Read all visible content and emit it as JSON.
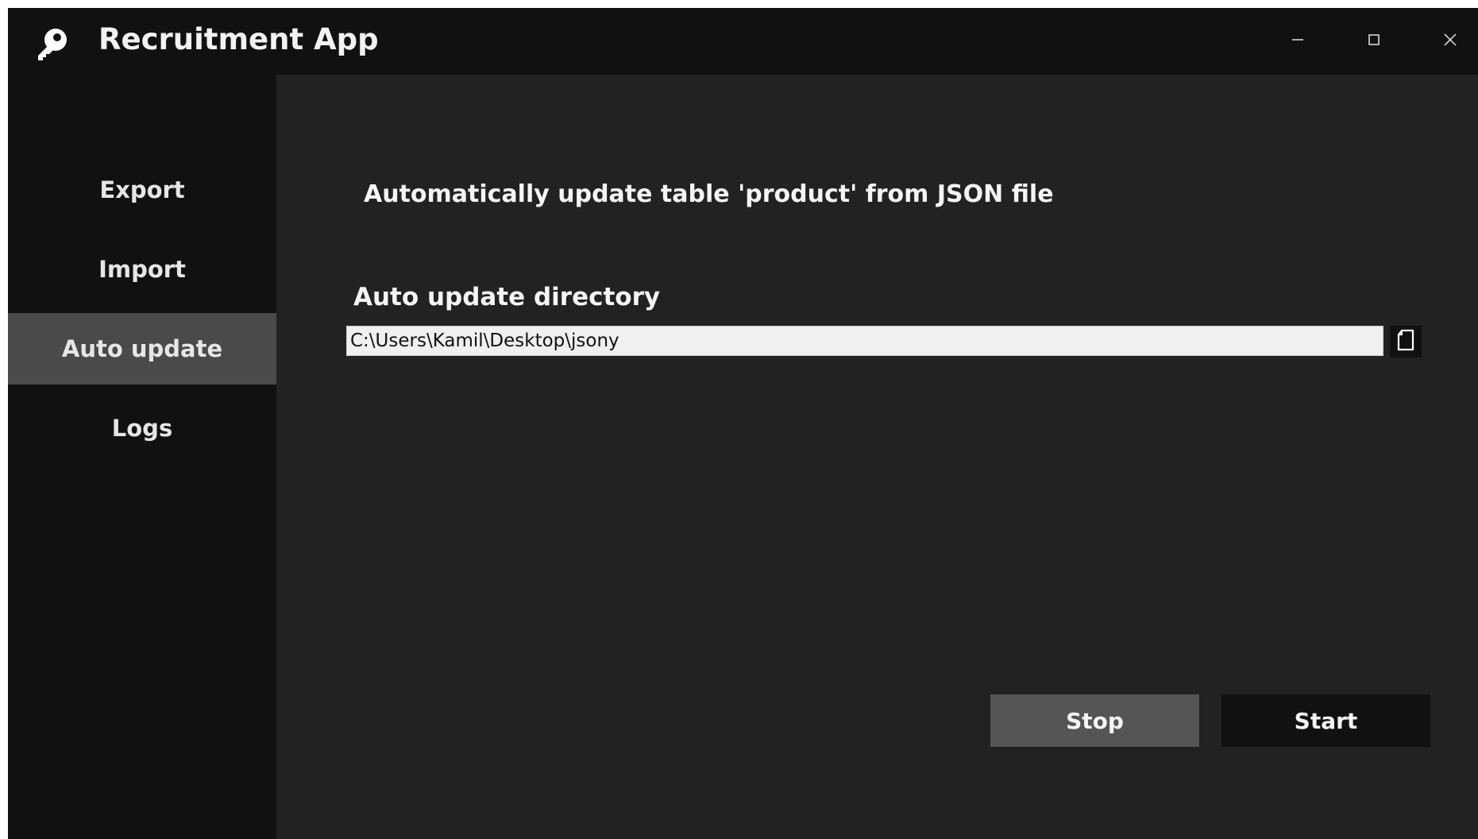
{
  "window": {
    "title": "Recruitment App",
    "icon": "key-icon",
    "controls": {
      "minimize_icon": "minimize-icon",
      "maximize_icon": "maximize-icon",
      "close_icon": "close-icon"
    }
  },
  "sidebar": {
    "items": [
      {
        "label": "Export",
        "active": false
      },
      {
        "label": "Import",
        "active": false
      },
      {
        "label": "Auto update",
        "active": true
      },
      {
        "label": "Logs",
        "active": false
      }
    ]
  },
  "main": {
    "heading": "Automatically update table 'product' from JSON file",
    "directory": {
      "label": "Auto update directory",
      "value": "C:\\Users\\Kamil\\Desktop\\jsony",
      "browse_icon": "folder-icon"
    },
    "buttons": {
      "stop_label": "Stop",
      "start_label": "Start"
    }
  },
  "colors": {
    "titlebar_bg": "#111111",
    "sidebar_bg": "#111111",
    "sidebar_active_bg": "#4a4a4a",
    "content_bg": "#222222",
    "stop_button_bg": "#555555",
    "start_button_bg": "#111111",
    "text": "#f5f5f5"
  }
}
